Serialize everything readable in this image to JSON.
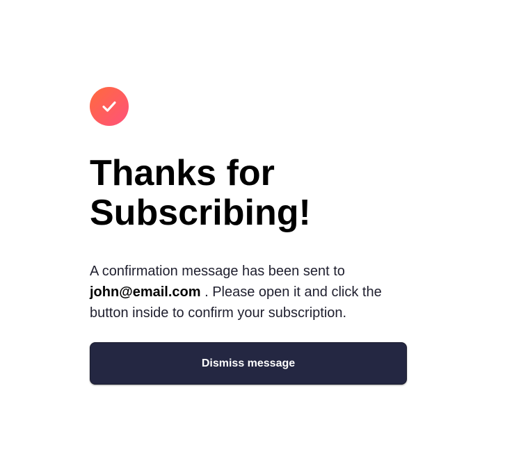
{
  "confirmation": {
    "icon": "checkmark-icon",
    "icon_gradient": [
      "#ff6a3d",
      "#ff527b"
    ],
    "title": "Thanks for Subscribing!",
    "message_prefix": "A confirmation message has been sent to",
    "email": "john@email.com",
    "message_suffix": ". Please open it and click the button inside to confirm your subscription.",
    "dismiss_label": "Dismiss message",
    "button_color": "#242742"
  }
}
